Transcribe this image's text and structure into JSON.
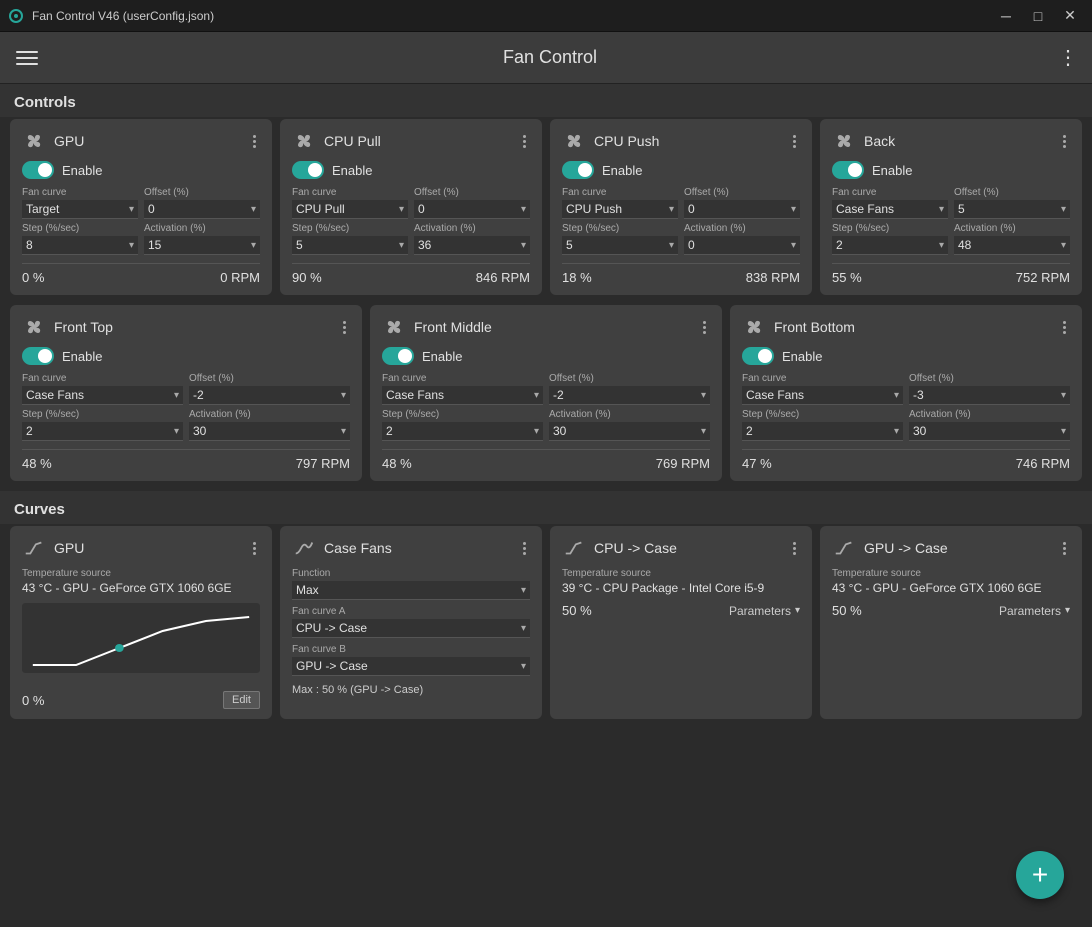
{
  "titleBar": {
    "title": "Fan Control V46 (userConfig.json)",
    "minLabel": "─",
    "maxLabel": "□",
    "closeLabel": "✕"
  },
  "navBar": {
    "appTitle": "Fan Control",
    "moreLabel": "⋮"
  },
  "sections": {
    "controls": "Controls",
    "curves": "Curves"
  },
  "controlCards": [
    {
      "title": "GPU",
      "toggleEnabled": true,
      "toggleLabel": "Enable",
      "fanCurveLabel": "Fan curve",
      "fanCurveValue": "Target",
      "offsetLabel": "Offset (%)",
      "offsetValue": "0",
      "stepLabel": "Step (%/sec)",
      "stepValue": "8",
      "activationLabel": "Activation (%)",
      "activationValue": "15",
      "pct": "0 %",
      "rpm": "0 RPM"
    },
    {
      "title": "CPU Pull",
      "toggleEnabled": true,
      "toggleLabel": "Enable",
      "fanCurveLabel": "Fan curve",
      "fanCurveValue": "CPU Pull",
      "offsetLabel": "Offset (%)",
      "offsetValue": "0",
      "stepLabel": "Step (%/sec)",
      "stepValue": "5",
      "activationLabel": "Activation (%)",
      "activationValue": "36",
      "pct": "90 %",
      "rpm": "846 RPM"
    },
    {
      "title": "CPU Push",
      "toggleEnabled": true,
      "toggleLabel": "Enable",
      "fanCurveLabel": "Fan curve",
      "fanCurveValue": "CPU Push",
      "offsetLabel": "Offset (%)",
      "offsetValue": "0",
      "stepLabel": "Step (%/sec)",
      "stepValue": "5",
      "activationLabel": "Activation (%)",
      "activationValue": "0",
      "pct": "18 %",
      "rpm": "838 RPM"
    },
    {
      "title": "Back",
      "toggleEnabled": true,
      "toggleLabel": "Enable",
      "fanCurveLabel": "Fan curve",
      "fanCurveValue": "Case Fans",
      "offsetLabel": "Offset (%)",
      "offsetValue": "5",
      "stepLabel": "Step (%/sec)",
      "stepValue": "2",
      "activationLabel": "Activation (%)",
      "activationValue": "48",
      "pct": "55 %",
      "rpm": "752 RPM"
    },
    {
      "title": "Front Top",
      "toggleEnabled": true,
      "toggleLabel": "Enable",
      "fanCurveLabel": "Fan curve",
      "fanCurveValue": "Case Fans",
      "offsetLabel": "Offset (%)",
      "offsetValue": "-2",
      "stepLabel": "Step (%/sec)",
      "stepValue": "2",
      "activationLabel": "Activation (%)",
      "activationValue": "30",
      "pct": "48 %",
      "rpm": "797 RPM"
    },
    {
      "title": "Front Middle",
      "toggleEnabled": true,
      "toggleLabel": "Enable",
      "fanCurveLabel": "Fan curve",
      "fanCurveValue": "Case Fans",
      "offsetLabel": "Offset (%)",
      "offsetValue": "-2",
      "stepLabel": "Step (%/sec)",
      "stepValue": "2",
      "activationLabel": "Activation (%)",
      "activationValue": "30",
      "pct": "48 %",
      "rpm": "769 RPM"
    },
    {
      "title": "Front Bottom",
      "toggleEnabled": true,
      "toggleLabel": "Enable",
      "fanCurveLabel": "Fan curve",
      "fanCurveValue": "Case Fans",
      "offsetLabel": "Offset (%)",
      "offsetValue": "-3",
      "stepLabel": "Step (%/sec)",
      "stepValue": "2",
      "activationLabel": "Activation (%)",
      "activationValue": "30",
      "pct": "47 %",
      "rpm": "746 RPM"
    }
  ],
  "curveCards": [
    {
      "title": "GPU",
      "type": "line",
      "tempSourceLabel": "Temperature source",
      "tempSourceValue": "43 °C - GPU - GeForce GTX 1060 6GE",
      "pct": "0 %",
      "editLabel": "Edit",
      "hasChart": true
    },
    {
      "title": "Case Fans",
      "type": "max",
      "functionLabel": "Function",
      "functionValue": "Max",
      "fanCurveALabel": "Fan curve A",
      "fanCurveAValue": "CPU -> Case",
      "fanCurveBLabel": "Fan curve B",
      "fanCurveBValue": "GPU -> Case",
      "summaryValue": "Max : 50 % (GPU -> Case)",
      "hasChart": false
    },
    {
      "title": "CPU -> Case",
      "type": "line",
      "tempSourceLabel": "Temperature source",
      "tempSourceValue": "39 °C - CPU Package - Intel Core i5-9",
      "pct": "50 %",
      "parametersLabel": "Parameters",
      "hasChart": false
    },
    {
      "title": "GPU -> Case",
      "type": "line",
      "tempSourceLabel": "Temperature source",
      "tempSourceValue": "43 °C - GPU - GeForce GTX 1060 6GE",
      "pct": "50 %",
      "parametersLabel": "Parameters",
      "hasChart": false
    }
  ],
  "fab": {
    "label": "+"
  }
}
